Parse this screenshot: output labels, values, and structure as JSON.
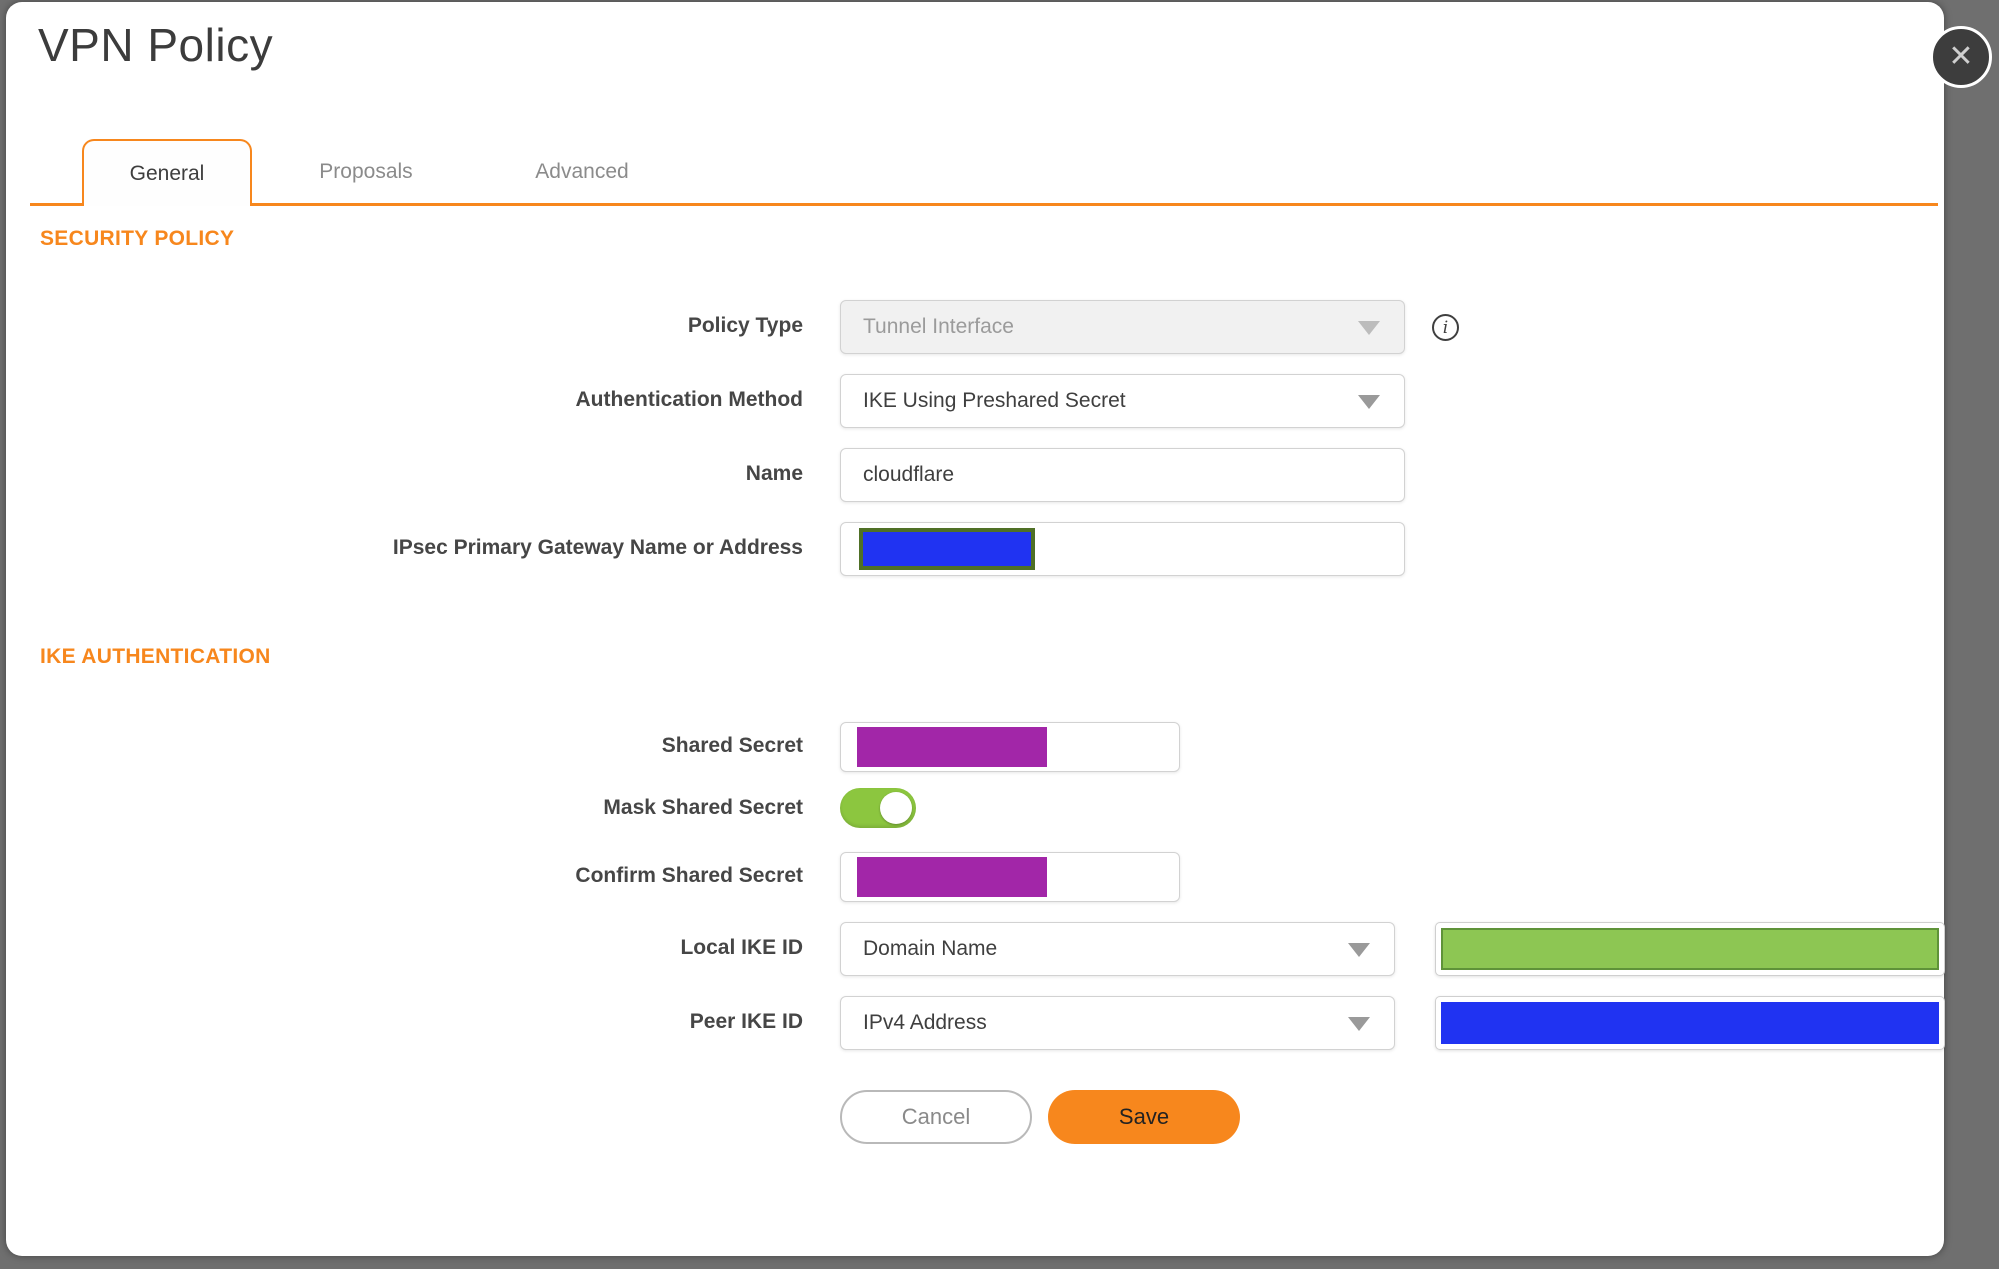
{
  "dialog": {
    "title": "VPN Policy"
  },
  "tabs": [
    {
      "label": "General",
      "active": true
    },
    {
      "label": "Proposals",
      "active": false
    },
    {
      "label": "Advanced",
      "active": false
    }
  ],
  "sections": {
    "security_policy": "SECURITY POLICY",
    "ike_authentication": "IKE AUTHENTICATION"
  },
  "fields": {
    "policy_type": {
      "label": "Policy Type",
      "value": "Tunnel Interface",
      "disabled": true
    },
    "authentication_method": {
      "label": "Authentication Method",
      "value": "IKE Using Preshared Secret"
    },
    "name": {
      "label": "Name",
      "value": "cloudflare"
    },
    "gateway": {
      "label": "IPsec Primary Gateway Name or Address",
      "value": "",
      "redacted": "blue-box"
    },
    "shared_secret": {
      "label": "Shared Secret",
      "redacted": "purple-box"
    },
    "mask_shared_secret": {
      "label": "Mask Shared Secret",
      "state": "on"
    },
    "confirm_shared_secret": {
      "label": "Confirm Shared Secret",
      "redacted": "purple-box"
    },
    "local_ike_id": {
      "label": "Local IKE ID",
      "value": "Domain Name",
      "redacted": "green-box"
    },
    "peer_ike_id": {
      "label": "Peer IKE ID",
      "value": "IPv4 Address",
      "redacted": "blue-box"
    }
  },
  "buttons": {
    "cancel": "Cancel",
    "save": "Save"
  },
  "icons": {
    "close": "✕",
    "info": "i",
    "dropdown": "caret-down"
  },
  "colors": {
    "orange": "#f7871d",
    "purple": "#a226a8",
    "blue": "#2033f2",
    "olive": "#4f7026",
    "green_fill": "#8dc653",
    "green_border": "#5f9339",
    "toggle_green": "#8cc63f"
  }
}
